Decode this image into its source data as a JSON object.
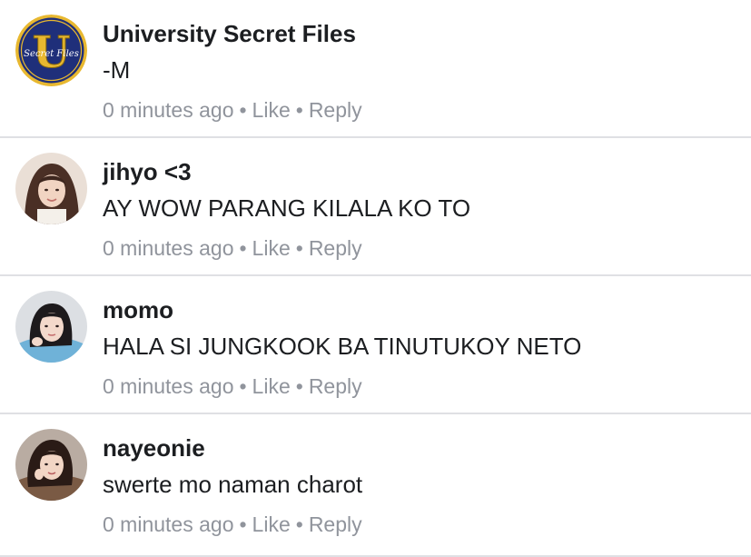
{
  "comments": [
    {
      "author": "University Secret Files",
      "text": "-M",
      "time": "0 minutes ago",
      "like_label": "Like",
      "reply_label": "Reply",
      "avatar": "university-secret-files-logo"
    },
    {
      "author": "jihyo <3",
      "text": "AY WOW PARANG KILALA KO TO",
      "time": "0 minutes ago",
      "like_label": "Like",
      "reply_label": "Reply",
      "avatar": "profile-photo"
    },
    {
      "author": "momo",
      "text": "HALA SI JUNGKOOK BA TINUTUKOY NETO",
      "time": "0 minutes ago",
      "like_label": "Like",
      "reply_label": "Reply",
      "avatar": "profile-photo"
    },
    {
      "author": "nayeonie",
      "text": "swerte mo naman charot",
      "time": "0 minutes ago",
      "like_label": "Like",
      "reply_label": "Reply",
      "avatar": "profile-photo"
    }
  ],
  "logo": {
    "letter": "U",
    "script": "Secret Files"
  },
  "separator": "•",
  "colors": {
    "meta_text": "#90949c",
    "divider": "#dfe0e4",
    "logo_navy": "#1f2f7a",
    "logo_gold": "#e8b830"
  }
}
